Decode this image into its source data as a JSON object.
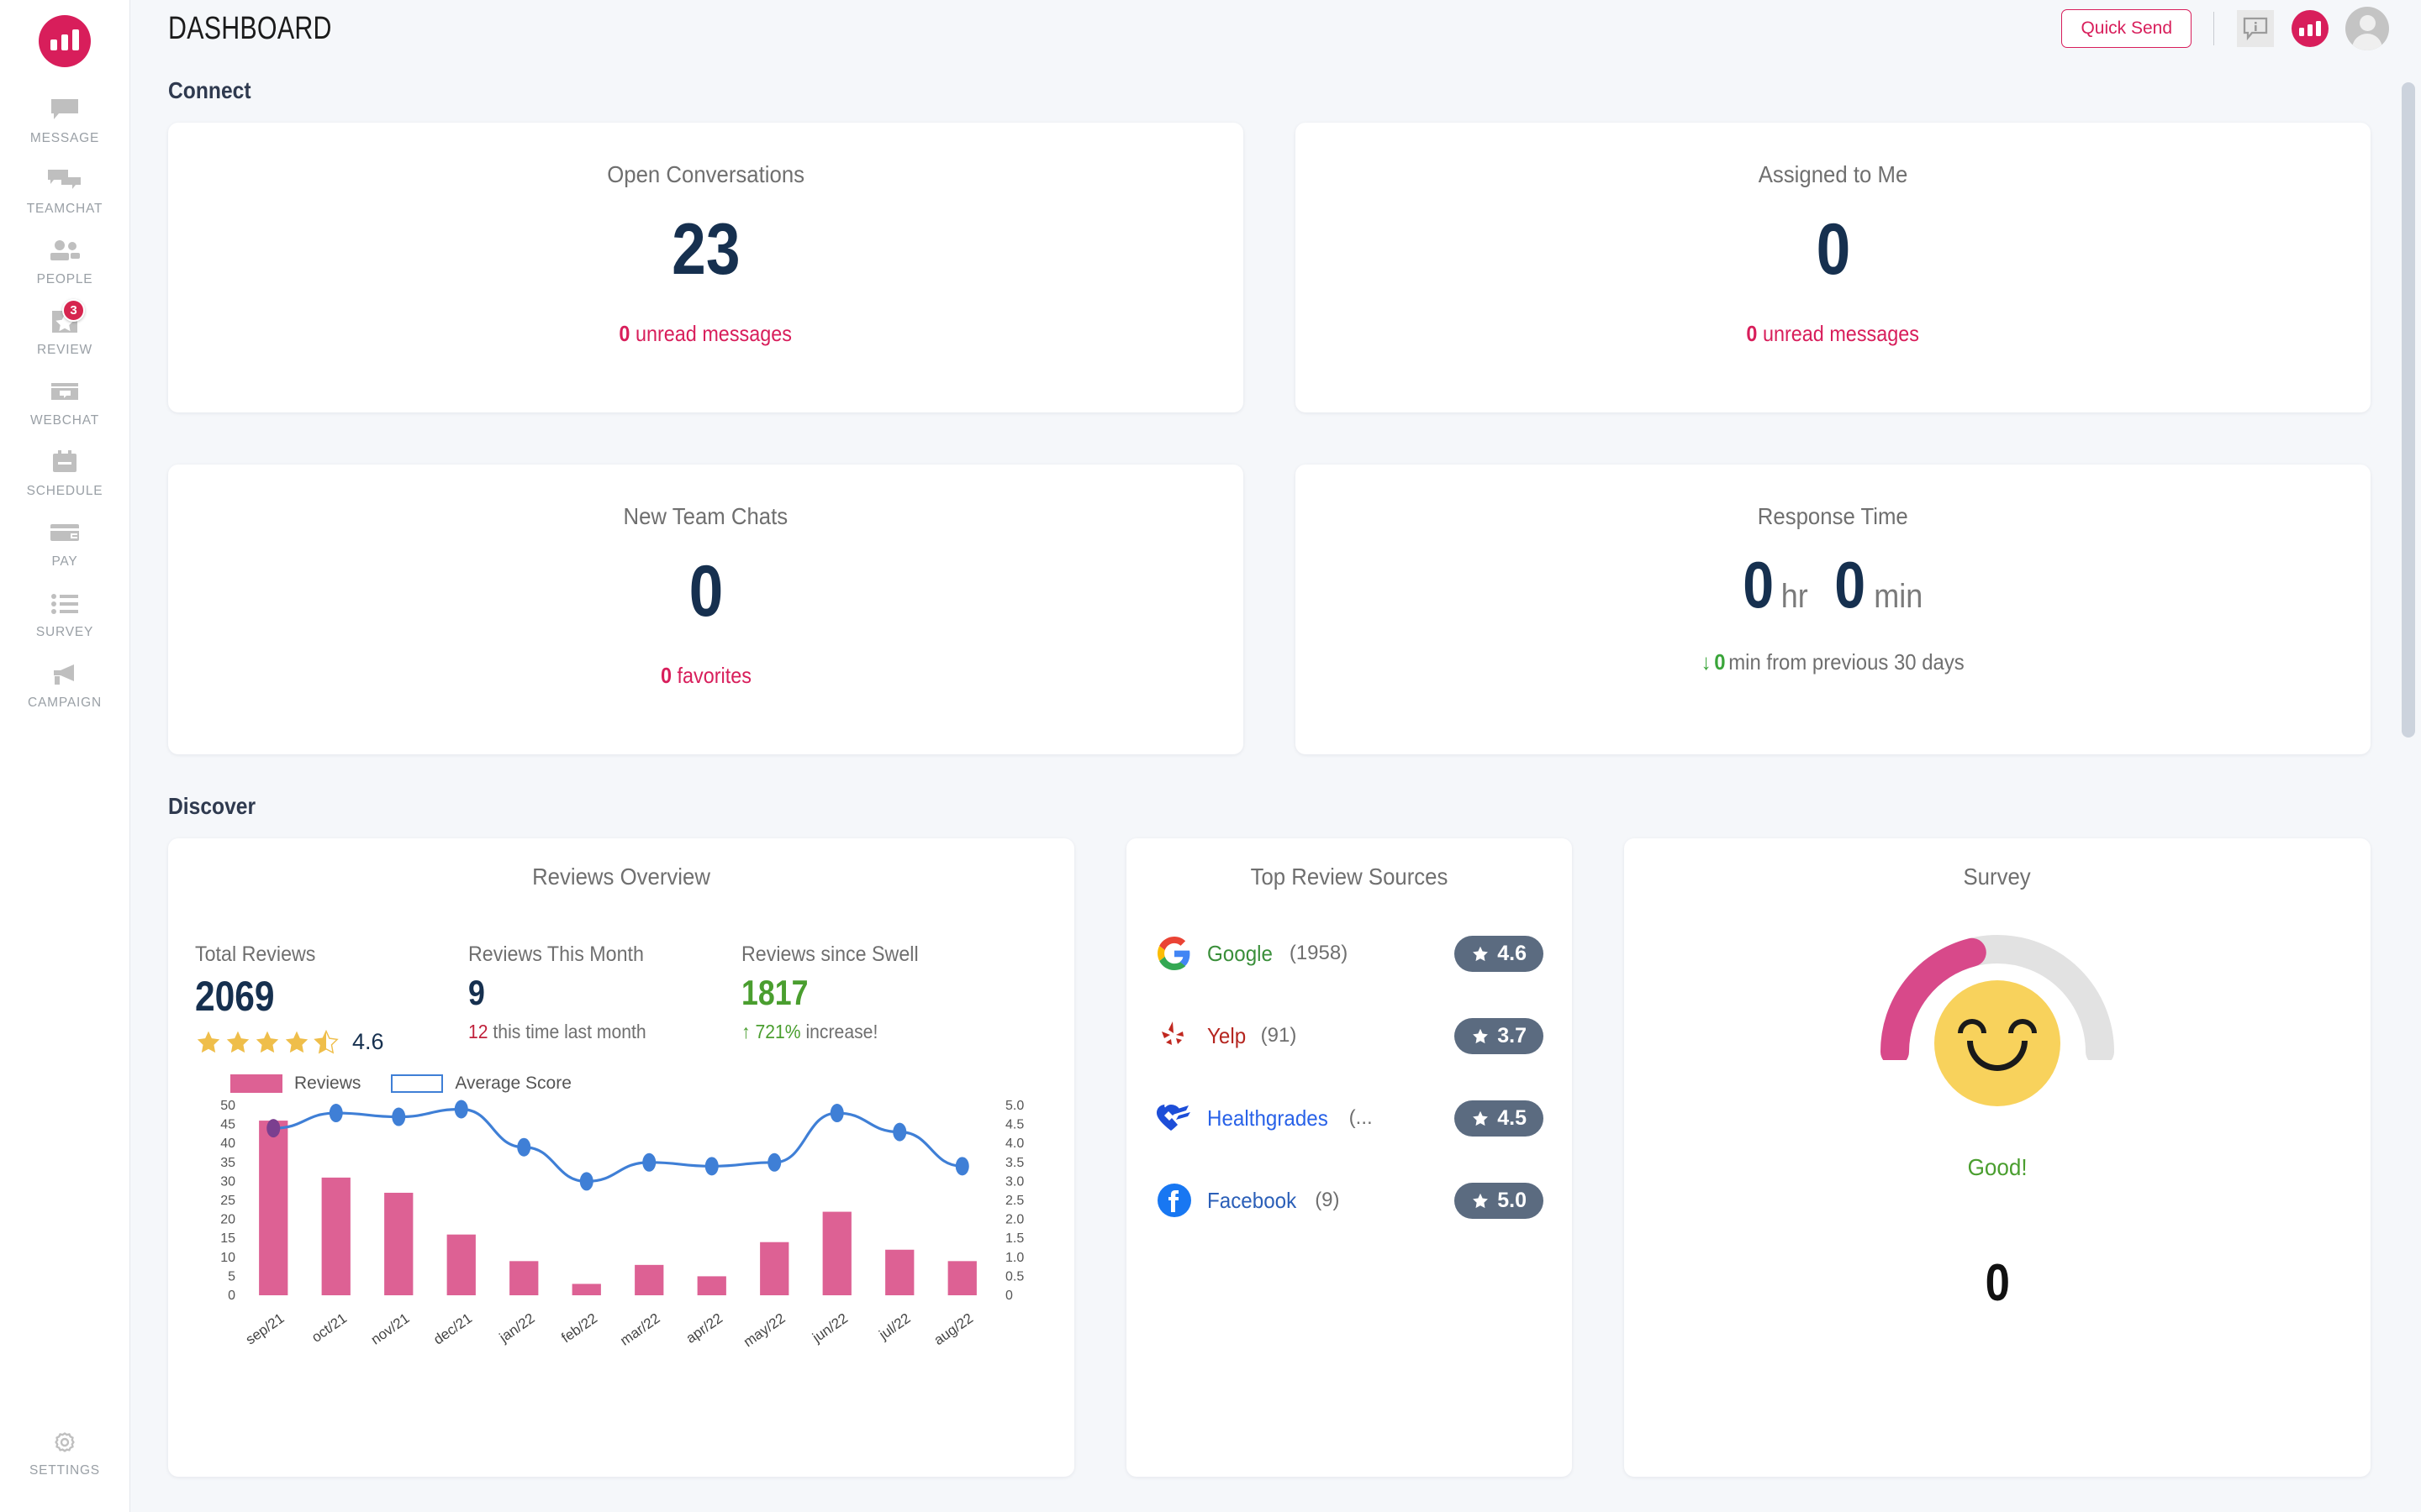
{
  "app": {
    "title": "DASHBOARD",
    "brand_color": "#d81e5b",
    "accent_navy": "#16304f"
  },
  "sidebar": {
    "logo_name": "swell-logo",
    "items": [
      {
        "label": "MESSAGE",
        "icon": "message-icon",
        "badge": null
      },
      {
        "label": "TEAMCHAT",
        "icon": "teamchat-icon",
        "badge": null
      },
      {
        "label": "PEOPLE",
        "icon": "people-icon",
        "badge": null
      },
      {
        "label": "REVIEW",
        "icon": "review-star-icon",
        "badge": "3"
      },
      {
        "label": "WEBCHAT",
        "icon": "webchat-icon",
        "badge": null
      },
      {
        "label": "SCHEDULE",
        "icon": "schedule-icon",
        "badge": null
      },
      {
        "label": "PAY",
        "icon": "pay-card-icon",
        "badge": null
      },
      {
        "label": "SURVEY",
        "icon": "survey-list-icon",
        "badge": null
      },
      {
        "label": "CAMPAIGN",
        "icon": "campaign-megaphone-icon",
        "badge": null
      }
    ],
    "settings": {
      "label": "SETTINGS",
      "icon": "gear-icon"
    }
  },
  "topbar": {
    "quick_send_label": "Quick Send",
    "info_icon": "info-chat-icon",
    "brand_icon": "brand-bars-icon",
    "avatar_icon": "user-avatar"
  },
  "sections": {
    "connect": "Connect",
    "discover": "Discover"
  },
  "connect_cards": [
    {
      "title": "Open Conversations",
      "value": "23",
      "sub_num": "0",
      "sub_text": "unread messages"
    },
    {
      "title": "Assigned to Me",
      "value": "0",
      "sub_num": "0",
      "sub_text": "unread messages"
    },
    {
      "title": "New Team Chats",
      "value": "0",
      "sub_num": "0",
      "sub_text": "favorites"
    }
  ],
  "response_time": {
    "title": "Response Time",
    "hours": "0",
    "hours_unit": "hr",
    "minutes": "0",
    "minutes_unit": "min",
    "delta_arrow": "↓",
    "delta_value": "0",
    "delta_text": "min from previous 30 days"
  },
  "reviews_overview": {
    "title": "Reviews Overview",
    "total_label": "Total Reviews",
    "total_value": "2069",
    "rating_value": "4.6",
    "stars_filled": 4,
    "stars_half": 1,
    "month_label": "Reviews This Month",
    "month_value": "9",
    "month_note_num": "12",
    "month_note_text": "this time last month",
    "since_label": "Reviews since Swell",
    "since_value": "1817",
    "since_arrow": "↑",
    "since_pct": "721%",
    "since_note": "increase!"
  },
  "chart_data": {
    "type": "bar",
    "title": "Reviews Overview",
    "categories": [
      "sep/21",
      "oct/21",
      "nov/21",
      "dec/21",
      "jan/22",
      "feb/22",
      "mar/22",
      "apr/22",
      "may/22",
      "jun/22",
      "jul/22",
      "aug/22"
    ],
    "series": [
      {
        "name": "Reviews",
        "type": "bar",
        "color": "#dd6194",
        "axis": "left",
        "values": [
          46,
          31,
          27,
          16,
          9,
          3,
          8,
          5,
          14,
          22,
          12,
          9
        ]
      },
      {
        "name": "Average Score",
        "type": "line",
        "color": "#3f7fd6",
        "axis": "right",
        "values": [
          4.4,
          4.8,
          4.7,
          4.9,
          3.9,
          3.0,
          3.5,
          3.4,
          3.5,
          4.8,
          4.3,
          3.4
        ]
      }
    ],
    "legend": [
      "Reviews",
      "Average Score"
    ],
    "legend_position": "top-left",
    "y_left_label": "",
    "y_left_ticks": [
      "50",
      "45",
      "40",
      "35",
      "30",
      "25",
      "20",
      "15",
      "10",
      "5",
      "0"
    ],
    "ylim_left": [
      0,
      50
    ],
    "y_right_ticks": [
      "5.0",
      "4.5",
      "4.0",
      "3.5",
      "3.0",
      "2.5",
      "2.0",
      "1.5",
      "1.0",
      "0.5",
      "0"
    ],
    "ylim_right": [
      0,
      5
    ],
    "grid": false
  },
  "top_review_sources": {
    "title": "Top Review Sources",
    "rows": [
      {
        "name": "Google",
        "icon": "google-icon",
        "name_color": "#3a8f3a",
        "count": "(1958)",
        "rating": "4.6"
      },
      {
        "name": "Yelp",
        "icon": "yelp-icon",
        "name_color": "#b5251f",
        "count": "(91)",
        "rating": "3.7"
      },
      {
        "name": "Healthgrades",
        "icon": "healthgrades-icon",
        "name_color": "#2962e8",
        "count": "(...",
        "rating": "4.5"
      },
      {
        "name": "Facebook",
        "icon": "facebook-icon",
        "name_color": "#2b5fb8",
        "count": "(9)",
        "rating": "5.0"
      }
    ]
  },
  "survey": {
    "title": "Survey",
    "gauge_icon": "gauge-arc",
    "face_icon": "smiling-face-icon",
    "status": "Good!",
    "status_color": "#4a9e2f",
    "value": "0",
    "gauge_percent": 42,
    "gauge_fill_color": "#d8498a",
    "gauge_track_color": "#e2e2e2"
  }
}
